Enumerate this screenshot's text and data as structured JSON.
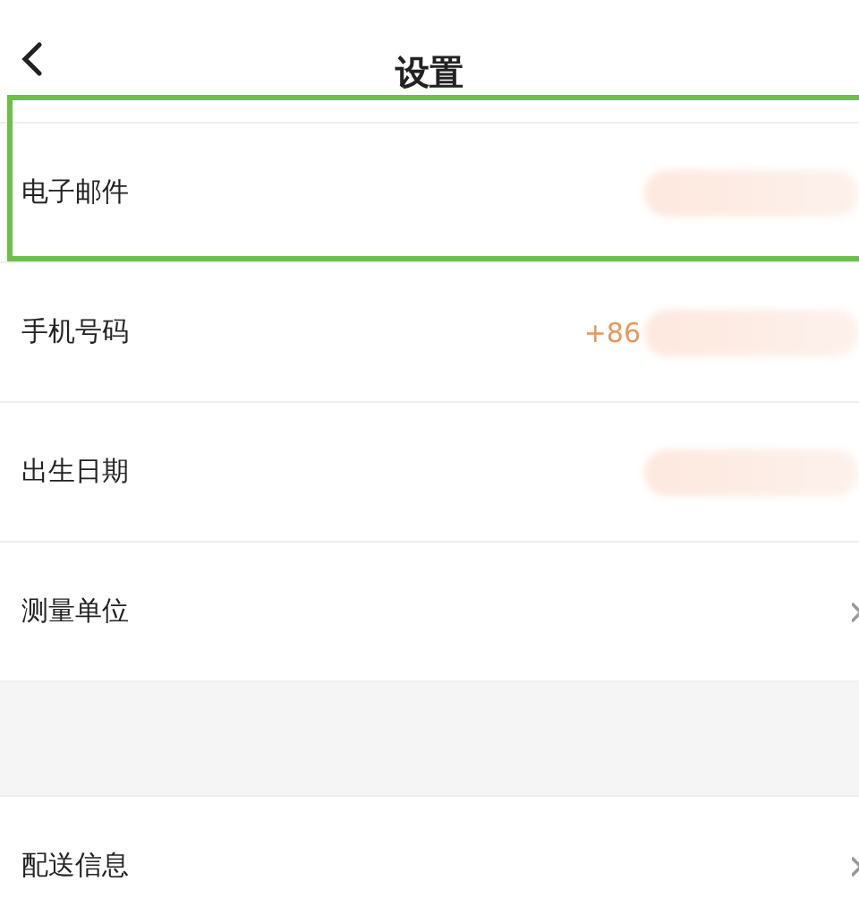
{
  "header": {
    "title": "设置"
  },
  "sections": [
    {
      "items": [
        {
          "label": "电子邮件",
          "redacted": true,
          "chevron": false,
          "highlighted": true
        },
        {
          "label": "手机号码",
          "value": "+86",
          "redacted": true,
          "chevron": false,
          "highlighted": false
        },
        {
          "label": "出生日期",
          "redacted": true,
          "chevron": false,
          "highlighted": false
        },
        {
          "label": "测量单位",
          "redacted": false,
          "chevron": true,
          "highlighted": false
        }
      ]
    },
    {
      "items": [
        {
          "label": "配送信息",
          "redacted": false,
          "chevron": true,
          "highlighted": false
        }
      ]
    }
  ]
}
